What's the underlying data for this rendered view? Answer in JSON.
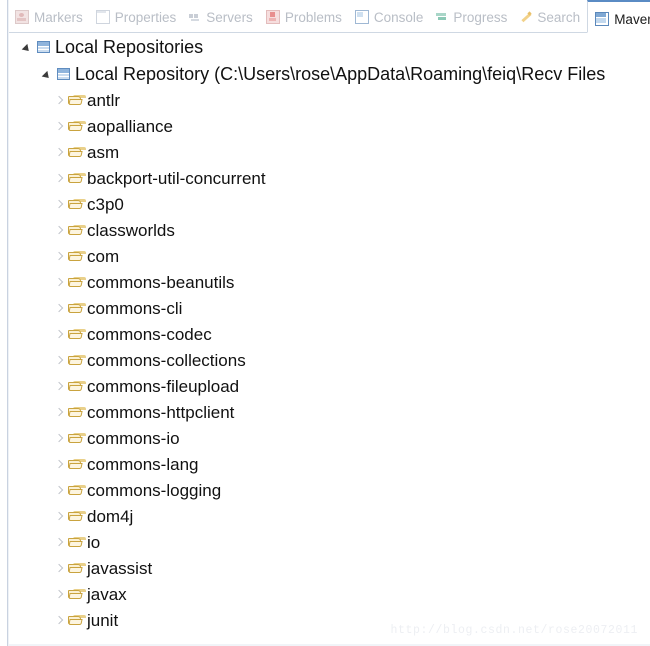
{
  "window": {
    "title": "Maven Repositories"
  },
  "tabbar": {
    "tabs": [
      {
        "label": "Markers",
        "icon": "markers-icon",
        "selected": false,
        "closable": false
      },
      {
        "label": "Properties",
        "icon": "properties-icon",
        "selected": false,
        "closable": false
      },
      {
        "label": "Servers",
        "icon": "servers-icon",
        "selected": false,
        "closable": false
      },
      {
        "label": "Problems",
        "icon": "problems-icon",
        "selected": false,
        "closable": false
      },
      {
        "label": "Console",
        "icon": "console-icon",
        "selected": false,
        "closable": false
      },
      {
        "label": "Progress",
        "icon": "progress-icon",
        "selected": false,
        "closable": false
      },
      {
        "label": "Search",
        "icon": "search-icon",
        "selected": false,
        "closable": false
      },
      {
        "label": "Maven Repositories",
        "icon": "maven-repositories-icon",
        "selected": true,
        "closable": true
      },
      {
        "label": "",
        "icon": "partial-tab-icon",
        "selected": false,
        "closable": false
      }
    ]
  },
  "tree": {
    "root": {
      "label": "Local Repositories",
      "icon": "repository-icon",
      "expanded": true
    },
    "local_repository": {
      "label": "Local Repository (C:\\Users\\rose\\AppData\\Roaming\\feiq\\Recv Files",
      "icon": "repository-icon",
      "expanded": true
    },
    "artifacts": [
      {
        "label": "antlr"
      },
      {
        "label": "aopalliance"
      },
      {
        "label": "asm"
      },
      {
        "label": "backport-util-concurrent"
      },
      {
        "label": "c3p0"
      },
      {
        "label": "classworlds"
      },
      {
        "label": "com"
      },
      {
        "label": "commons-beanutils"
      },
      {
        "label": "commons-cli"
      },
      {
        "label": "commons-codec"
      },
      {
        "label": "commons-collections"
      },
      {
        "label": "commons-fileupload"
      },
      {
        "label": "commons-httpclient"
      },
      {
        "label": "commons-io"
      },
      {
        "label": "commons-lang"
      },
      {
        "label": "commons-logging"
      },
      {
        "label": "dom4j"
      },
      {
        "label": "io"
      },
      {
        "label": "javassist"
      },
      {
        "label": "javax"
      },
      {
        "label": "junit"
      }
    ]
  },
  "watermark": {
    "text": "http://blog.csdn.net/rose20072011"
  },
  "colors": {
    "selected_tab_top": "#5a8bc4",
    "tab_inactive_text": "#b9bec6",
    "tree_text": "#111111",
    "folder": "#c9a33f",
    "repository": "#5f8cbf",
    "watermark": "#edeff3"
  }
}
